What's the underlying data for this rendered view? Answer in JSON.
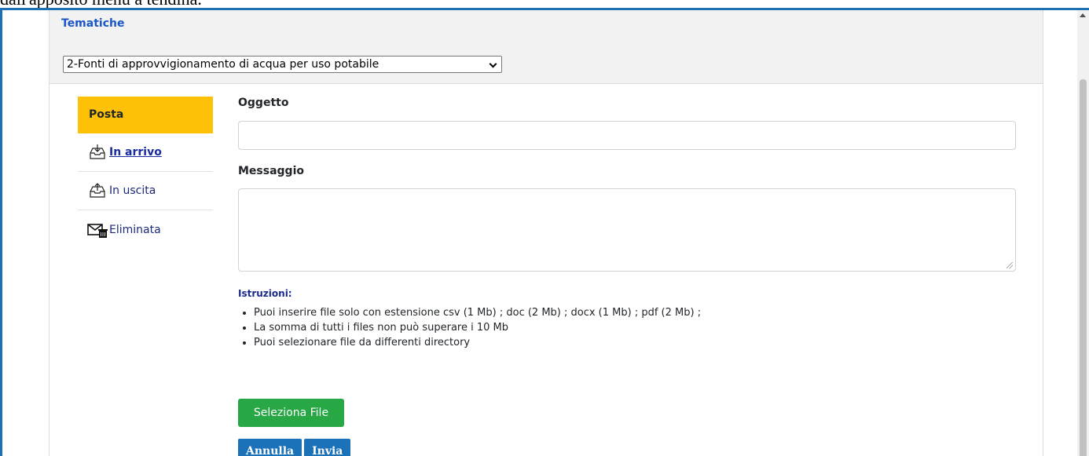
{
  "page_top_text": "dall'apposito menù a tendina.",
  "header": {
    "title": "Tematiche",
    "selected_topic": "2-Fonti di approvvigionamento di acqua per uso potabile"
  },
  "sidebar": {
    "title": "Posta",
    "items": [
      {
        "label": "In arrivo",
        "icon": "inbox-download-icon"
      },
      {
        "label": "In uscita",
        "icon": "outbox-upload-icon"
      },
      {
        "label": "Eliminata",
        "icon": "envelope-trash-icon"
      }
    ]
  },
  "form": {
    "oggetto_label": "Oggetto",
    "oggetto_value": "",
    "messaggio_label": "Messaggio",
    "messaggio_value": "",
    "istruzioni_title": "Istruzioni:",
    "istruzioni": [
      "Puoi inserire file solo con estensione csv (1 Mb) ; doc (2 Mb) ; docx (1 Mb) ; pdf (2 Mb) ;",
      "La somma di tutti i files non può superare i 10 Mb",
      "Puoi selezionare file da differenti directory"
    ],
    "select_file_label": "Seleziona File",
    "cancel_label": "Annulla",
    "send_label": "Invia"
  },
  "colors": {
    "accent_blue": "#1b72b8",
    "posta_yellow": "#ffc107",
    "select_file_green": "#28a745",
    "frame_border": "#1f6fb5"
  }
}
